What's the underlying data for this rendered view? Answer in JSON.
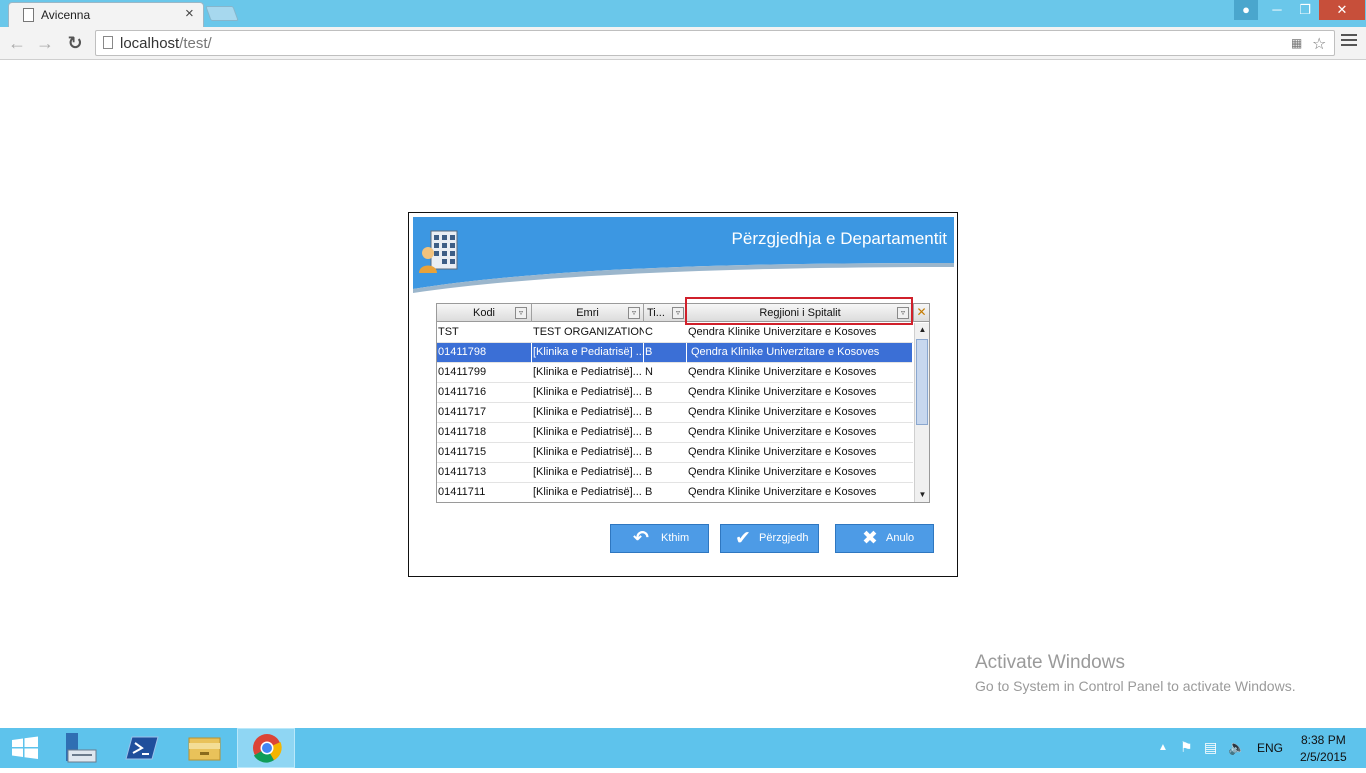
{
  "browser": {
    "tab_title": "Avicenna",
    "tab_close": "×",
    "url_host": "localhost",
    "url_path": "/test/"
  },
  "dialog": {
    "title": "Përzgjedhja e Departamentit",
    "columns": [
      "Kodi",
      "Emri",
      "Ti...",
      "Regjioni i Spitalit"
    ],
    "rows": [
      [
        "TST",
        "TEST ORGANIZATION",
        "C",
        "Qendra Klinike Univerzitare e Kosoves"
      ],
      [
        "01411798",
        "[Klinika e Pediatrisë] ...",
        "B",
        "Qendra Klinike Univerzitare e Kosoves"
      ],
      [
        "01411799",
        "[Klinika e Pediatrisë]...",
        "N",
        "Qendra Klinike Univerzitare e Kosoves"
      ],
      [
        "01411716",
        "[Klinika e Pediatrisë]...",
        "B",
        "Qendra Klinike Univerzitare e Kosoves"
      ],
      [
        "01411717",
        "[Klinika e Pediatrisë]...",
        "B",
        "Qendra Klinike Univerzitare e Kosoves"
      ],
      [
        "01411718",
        "[Klinika e Pediatrisë]...",
        "B",
        "Qendra Klinike Univerzitare e Kosoves"
      ],
      [
        "01411715",
        "[Klinika e Pediatrisë]...",
        "B",
        "Qendra Klinike Univerzitare e Kosoves"
      ],
      [
        "01411713",
        "[Klinika e Pediatrisë]...",
        "B",
        "Qendra Klinike Univerzitare e Kosoves"
      ],
      [
        "01411711",
        "[Klinika e Pediatrisë]...",
        "B",
        "Qendra Klinike Univerzitare e Kosoves"
      ]
    ],
    "selected_row": 1,
    "buttons": {
      "back": "Kthim",
      "select": "Përzgjedh",
      "cancel": "Anulo"
    }
  },
  "watermark": {
    "title": "Activate Windows",
    "subtitle": "Go to System in Control Panel to activate Windows."
  },
  "taskbar": {
    "language": "ENG",
    "time": "8:38 PM",
    "date": "2/5/2015"
  },
  "colors": {
    "titlebar": "#6ac7ea",
    "dialog_banner": "#3c97e2",
    "selection": "#3b6fd6",
    "highlight_box": "#d0202b",
    "button": "#4d9be6",
    "taskbar": "#5ec3ec"
  }
}
